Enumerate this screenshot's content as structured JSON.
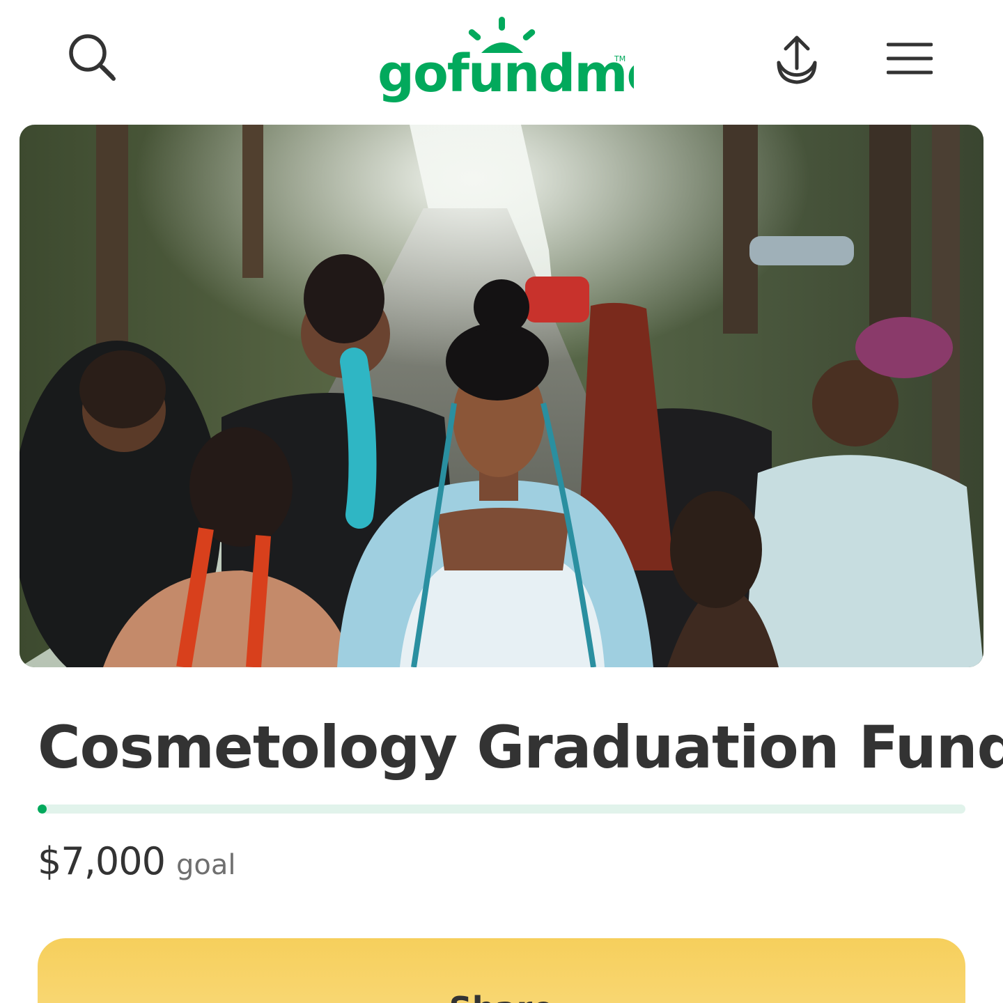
{
  "header": {
    "logo_text": "gofundme",
    "logo_mark": "TM",
    "search_icon": "search-icon",
    "share_icon": "share-upload-icon",
    "menu_icon": "hamburger-menu-icon"
  },
  "hero": {
    "image": "photo of a group of women with braided hairstyles on a tree-lined street"
  },
  "campaign": {
    "title": "Cosmetology Graduation Fund",
    "progress_fraction": 0.005,
    "goal_amount": "$7,000",
    "goal_label": "goal"
  },
  "actions": {
    "share_label": "Share"
  },
  "colors": {
    "brand_green": "#02a95c",
    "progress_track": "#e1f3eb",
    "share_button": "#f6cf5c",
    "text_dark": "#333333",
    "text_muted": "#6f6f6f"
  }
}
